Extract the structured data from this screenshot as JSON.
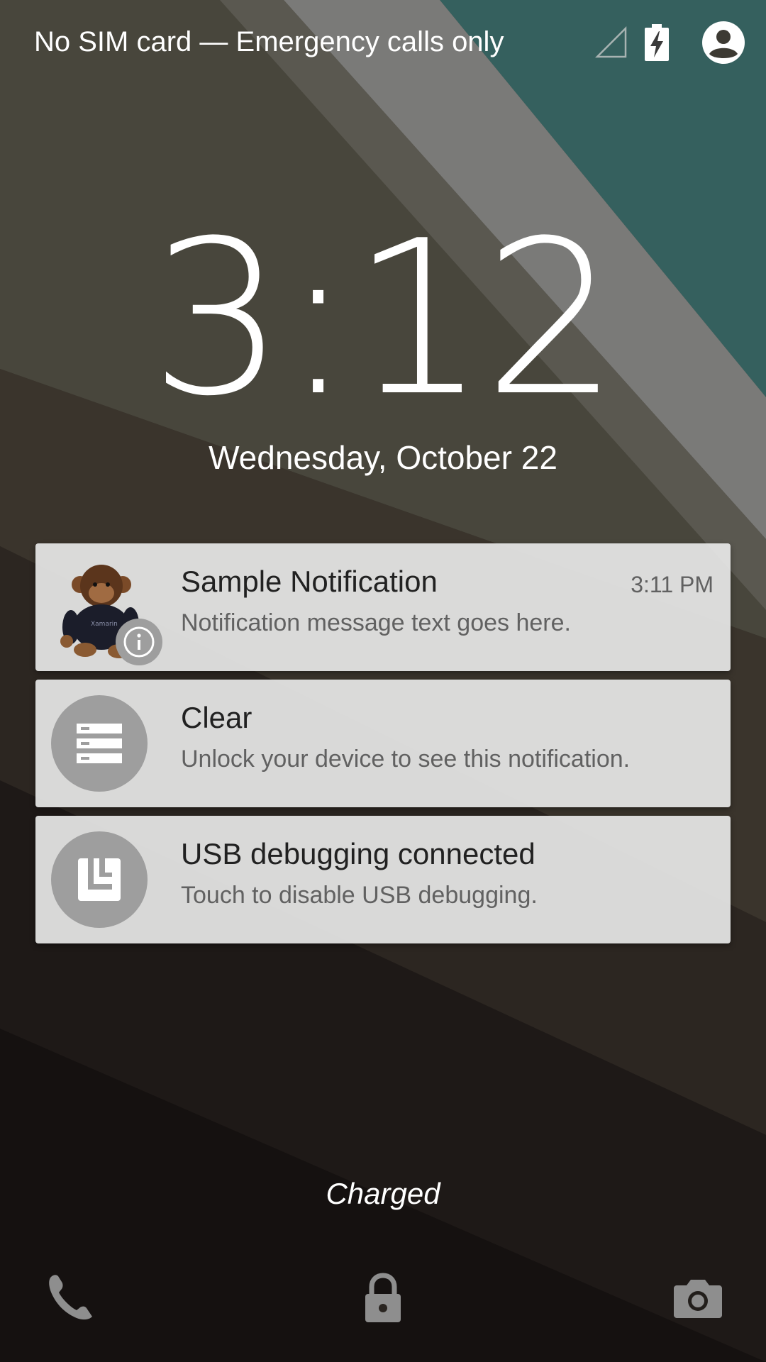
{
  "status_bar": {
    "carrier_text": "No SIM card — Emergency calls only",
    "icons": [
      "no-signal-icon",
      "battery-charging-icon",
      "user-avatar-icon"
    ]
  },
  "lockscreen": {
    "time": "3:12",
    "date": "Wednesday, October 22",
    "battery_status": "Charged"
  },
  "notifications": [
    {
      "title": "Sample Notification",
      "text": "Notification message text goes here.",
      "time": "3:11 PM",
      "icon": "monkey-image",
      "badge": "info-icon"
    },
    {
      "title": "Clear",
      "text": "Unlock your device to see this notification.",
      "icon": "list-icon"
    },
    {
      "title": "USB debugging connected",
      "text": "Touch to disable USB debugging.",
      "icon": "usb-debug-icon"
    }
  ],
  "bottom_actions": [
    "phone-icon",
    "lock-icon",
    "camera-icon"
  ],
  "colors": {
    "notification_bg": "#e8e8e8",
    "icon_circle": "#9e9e9e",
    "teal_wallpaper": "#35605e"
  }
}
